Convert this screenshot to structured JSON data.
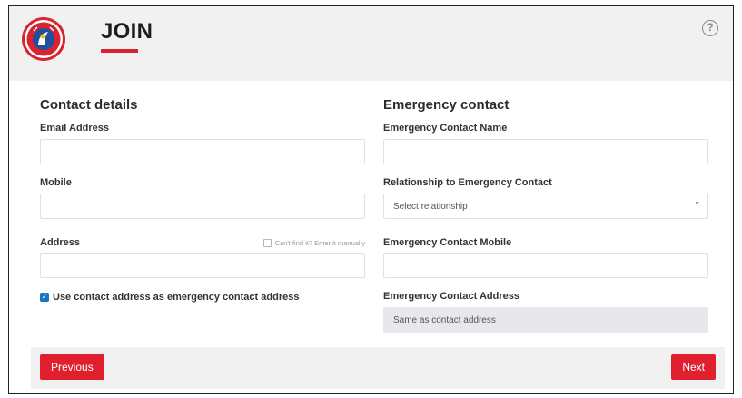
{
  "header": {
    "title": "JOIN",
    "help_glyph": "?",
    "logo_icon": "surf-life-saving-logo-icon",
    "accent": "#d9232e"
  },
  "contact": {
    "section_title": "Contact details",
    "email_label": "Email Address",
    "email_value": "",
    "mobile_label": "Mobile",
    "mobile_value": "",
    "address_label": "Address",
    "address_value": "",
    "manual_label": "Can't find it? Enter it manually",
    "manual_checked": false,
    "use_address_label": "Use contact address as emergency contact address",
    "use_address_checked": true
  },
  "emergency": {
    "section_title": "Emergency contact",
    "name_label": "Emergency Contact Name",
    "name_value": "",
    "relationship_label": "Relationship to Emergency Contact",
    "relationship_value": "Select relationship",
    "mobile_label": "Emergency Contact Mobile",
    "mobile_value": "",
    "address_label": "Emergency Contact Address",
    "address_value": "Same as contact address"
  },
  "footer": {
    "previous_label": "Previous",
    "next_label": "Next",
    "button_color": "#e0202f"
  },
  "colors": {
    "checkbox": "#1b73c6",
    "panel": "#f1f1f1"
  }
}
